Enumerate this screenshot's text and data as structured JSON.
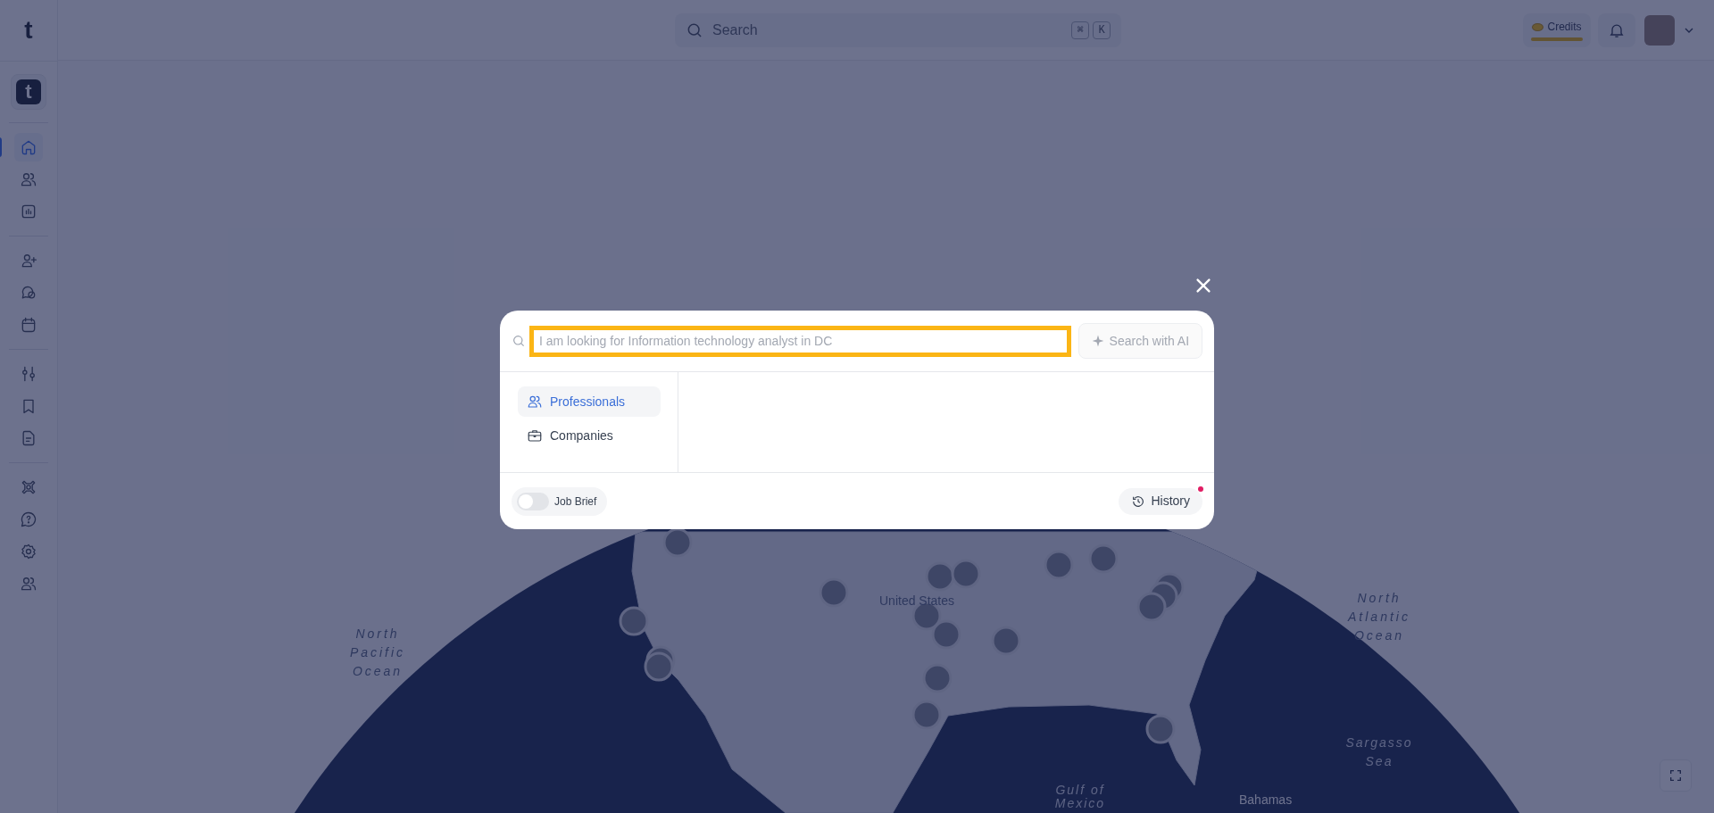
{
  "app": {
    "logo": "t",
    "badge_logo": "t"
  },
  "sidebar": {
    "groups": [
      [
        {
          "kind": "home",
          "selected": true
        },
        {
          "kind": "users",
          "selected": false
        },
        {
          "kind": "chart",
          "selected": false
        }
      ],
      [
        {
          "kind": "user-plus",
          "selected": false
        },
        {
          "kind": "chat",
          "selected": false
        },
        {
          "kind": "calendar",
          "selected": false
        }
      ],
      [
        {
          "kind": "sliders",
          "selected": false
        },
        {
          "kind": "bookmark",
          "selected": false
        },
        {
          "kind": "document",
          "selected": false
        }
      ],
      [
        {
          "kind": "lifebuoy",
          "selected": false
        },
        {
          "kind": "help",
          "selected": false
        },
        {
          "kind": "settings",
          "selected": false
        },
        {
          "kind": "users",
          "selected": false
        }
      ]
    ]
  },
  "topbar": {
    "search": {
      "placeholder": "Search",
      "keys": [
        "⌘",
        "K"
      ]
    },
    "credits": {
      "label": "Credits",
      "level": 1
    }
  },
  "map": {
    "labels": [
      "North Pacific Ocean",
      "United States",
      "North Atlantic Ocean",
      "Sargasso Sea",
      "Gulf of Mexico",
      "Bahamas"
    ]
  },
  "modal": {
    "search": {
      "placeholder": "I am looking for Information technology analyst in DC"
    },
    "ai_button": {
      "label": "Search with AI",
      "disabled": true
    },
    "categories": [
      {
        "label": "Professionals",
        "kind": "people",
        "selected": true
      },
      {
        "label": "Companies",
        "kind": "briefcase",
        "selected": false
      }
    ],
    "job_brief": {
      "label": "Job Brief",
      "on": false
    },
    "history": {
      "label": "History",
      "unread": true
    }
  }
}
